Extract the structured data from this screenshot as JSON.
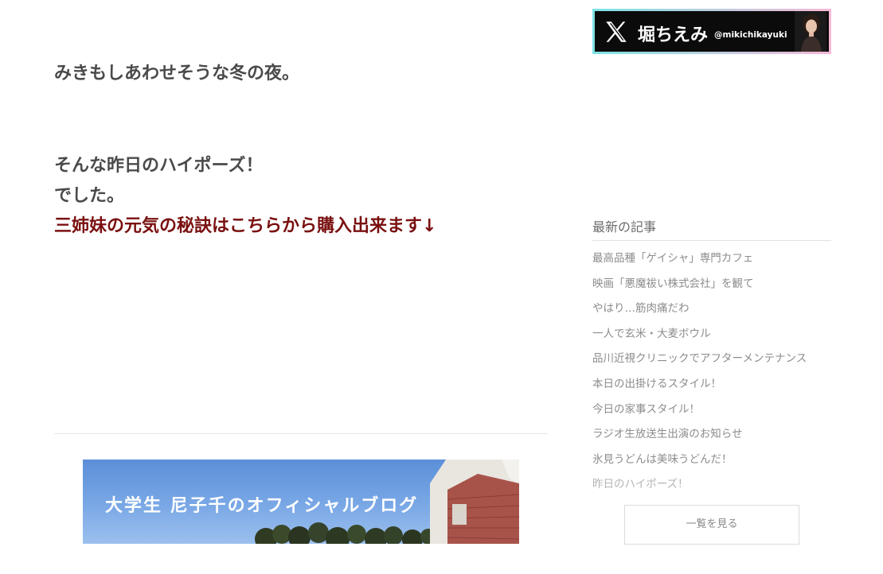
{
  "post": {
    "line1": "みきもしあわせそうな冬の夜。",
    "line2": "そんな昨日のハイポーズ！",
    "line3": "でした。",
    "promo_link": "三姉妹の元気の秘訣はこちらから購入出来ます↓"
  },
  "blog_banner": {
    "title": "大学生 尼子千のオフィシャルブログ"
  },
  "x_banner": {
    "logo_icon": "x-logo-icon",
    "name": "堀ちえみ",
    "handle": "@mikichikayuki",
    "colors": {
      "background": "#0b0b0b",
      "border_start": "#7fe3e6",
      "border_end": "#f5b8d6"
    }
  },
  "sidebar": {
    "heading": "最新の記事",
    "recent_articles": [
      "最高品種「ゲイシャ」専門カフェ",
      "映画「悪魔祓い株式会社」を観て",
      "やはり…筋肉痛だわ",
      "一人で玄米・大麦ボウル",
      "品川近視クリニックでアフターメンテナンス",
      "本日の出掛けるスタイル！",
      "今日の家事スタイル！",
      "ラジオ生放送生出演のお知らせ",
      "氷見うどんは美味うどんだ！",
      "昨日のハイポーズ！"
    ],
    "view_all_label": "一覧を見る"
  },
  "colors": {
    "body_text": "#4a4a4a",
    "promo_link": "#7a1010",
    "sidebar_link": "#8c8c8c",
    "sidebar_link_current": "#b4b4b4"
  }
}
